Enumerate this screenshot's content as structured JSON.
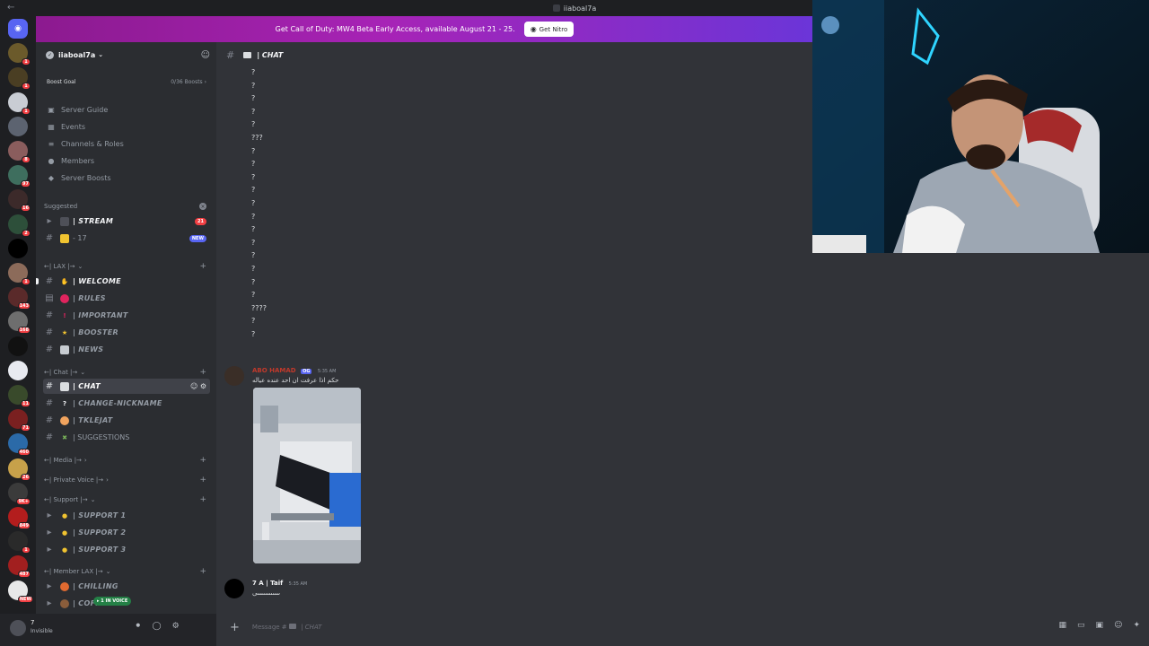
{
  "window": {
    "title": "iiaboal7a"
  },
  "banner": {
    "text": "Get Call of Duty: MW4 Beta Early Access, available August 21 - 25.",
    "button": "Get Nitro"
  },
  "server_rail": [
    {
      "name": "discord-home",
      "color": "#5865f2",
      "badge": ""
    },
    {
      "name": "server-1",
      "color": "#6b5a2b",
      "badge": "1"
    },
    {
      "name": "server-2",
      "color": "#4a3e23",
      "badge": "1"
    },
    {
      "name": "server-3",
      "color": "#c9cdd4",
      "badge": "1"
    },
    {
      "name": "server-4",
      "color": "#5c6370",
      "badge": ""
    },
    {
      "name": "server-5",
      "color": "#8a5d5d",
      "badge": "8"
    },
    {
      "name": "server-6",
      "color": "#3e6e5e",
      "badge": "97"
    },
    {
      "name": "server-7",
      "color": "#3c2a2a",
      "badge": "16"
    },
    {
      "name": "server-8",
      "color": "#2d4f3a",
      "badge": "2"
    },
    {
      "name": "server-9",
      "color": "#000000",
      "badge": ""
    },
    {
      "name": "server-10",
      "color": "#8c6b5a",
      "badge": "1"
    },
    {
      "name": "server-11",
      "color": "#5a2a2a",
      "badge": "143"
    },
    {
      "name": "server-12",
      "color": "#6e6e6e",
      "badge": "168"
    },
    {
      "name": "server-13",
      "color": "#111111",
      "badge": ""
    },
    {
      "name": "server-14",
      "color": "#e8eaf0",
      "badge": ""
    },
    {
      "name": "server-15",
      "color": "#394a2b",
      "badge": "11"
    },
    {
      "name": "server-16",
      "color": "#7a2020",
      "badge": "71"
    },
    {
      "name": "server-17",
      "color": "#2b6aa8",
      "badge": "460"
    },
    {
      "name": "server-18",
      "color": "#c7a14a",
      "badge": "26"
    },
    {
      "name": "server-19",
      "color": "#3b3b3b",
      "badge": "9K+"
    },
    {
      "name": "server-20",
      "color": "#b31d1d",
      "badge": "849"
    },
    {
      "name": "server-21",
      "color": "#2a2a2a",
      "badge": "1"
    },
    {
      "name": "server-22",
      "color": "#a21f1f",
      "badge": "487"
    },
    {
      "name": "server-23",
      "color": "#e8e8e8",
      "badge": "NEW"
    }
  ],
  "server": {
    "name": "iiaboal7a"
  },
  "boost": {
    "label": "Boost Goal",
    "count": "0/36 Boosts"
  },
  "nav": [
    {
      "label": "Server Guide"
    },
    {
      "label": "Events"
    },
    {
      "label": "Channels & Roles"
    },
    {
      "label": "Members"
    },
    {
      "label": "Server Boosts"
    }
  ],
  "suggested_label": "Suggested",
  "channels": {
    "stream": {
      "name": "| STREAM",
      "badge": "21"
    },
    "c17": {
      "name": "- 17",
      "badge": "NEW"
    },
    "cat_lax": "←| LAX |→",
    "welcome": "| WELCOME",
    "rules": "| RULES",
    "important": "| IMPORTANT",
    "booster": "| BOOSTER",
    "news": "| NEWS",
    "cat_chat": "←| Chat |→",
    "chat": "| CHAT",
    "change_nickname": "| CHANGE-NICKNAME",
    "tklejat": "| TKLEJAT",
    "suggestions": "| SUGGESTIONS",
    "cat_media": "←| Media |→",
    "cat_private": "←| Private Voice |→",
    "cat_support": "←| Support |→",
    "support1": "| SUPPORT 1",
    "support2": "| SUPPORT 2",
    "support3": "| SUPPORT 3",
    "cat_member": "←| Member LAX |→",
    "chilling": "| CHILLING",
    "coffee": "| COFF...",
    "in_voice": "1 IN VOICE"
  },
  "user": {
    "name": "7",
    "status": "Invisible"
  },
  "channel_header": {
    "name": "| CHAT"
  },
  "question_marks": [
    "?",
    "?",
    "?",
    "?",
    "?",
    "???",
    "?",
    "?",
    "?",
    "?",
    "?",
    "?",
    "?",
    "?",
    "?",
    "?",
    "?",
    "?",
    "????",
    "?",
    "?"
  ],
  "messages": [
    {
      "author": "ABO HAMAD",
      "author_color": "#c0392b",
      "tag": "OG",
      "time": "5:35 AM",
      "text": "حكم اذا عرفت ان احد عنده عياله"
    },
    {
      "author": "7 A | Taif",
      "author_color": "#f2f3f5",
      "tag": "",
      "time": "5:35 AM",
      "text": "ىىىىىىىىىىىىى"
    }
  ],
  "composer": {
    "placeholder": "Message #",
    "channel": "| CHAT"
  }
}
